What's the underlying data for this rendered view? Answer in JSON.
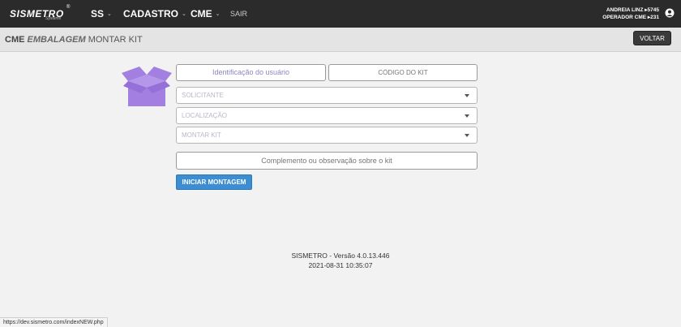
{
  "header": {
    "logo_text": "SISMETRO",
    "logo_reg": "®",
    "logo_sub": "Systems",
    "nav": {
      "ss": "SS",
      "cadastro": "CADASTRO",
      "cme": "CME",
      "sair": "SAIR"
    },
    "chevron_glyph": "⌄",
    "user_line1": "ANDREIA LINZ ▸5745",
    "user_line2": "OPERADOR CME ▸231",
    "avatar_icon": "user-circle-icon"
  },
  "subheader": {
    "title_part1": "CME",
    "title_part2": "EMBALAGEM",
    "title_part3": "MONTAR KIT",
    "voltar_label": "VOLTAR"
  },
  "form": {
    "identificacao_label": "Identificação do usuário",
    "codigo_kit_placeholder": "CÓDIGO DO KIT",
    "solicitante_label": "SOLICITANTE",
    "localizacao_label": "LOCALIZAÇÃO",
    "montar_kit_label": "MONTAR KIT",
    "complemento_placeholder": "Complemento ou observação sobre o kit",
    "iniciar_label": "INICIAR MONTAGEM",
    "box_icon": "open-box-icon",
    "box_color": "#a27fe0"
  },
  "footer": {
    "version": "SISMETRO - Versão 4.0.13.446",
    "datetime": "2021-08-31 10:35:07"
  },
  "status_url": "https://dev.sismetro.com/indexNEW.php"
}
